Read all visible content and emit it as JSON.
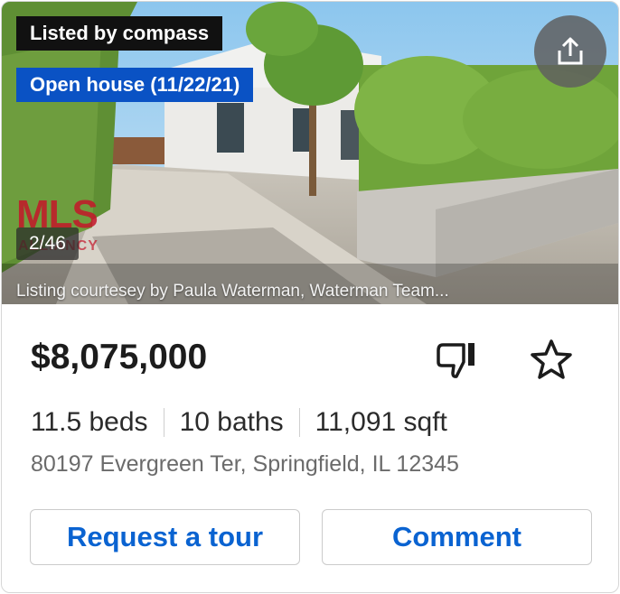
{
  "listing": {
    "listed_by": "Listed by compass",
    "open_house": "Open house (11/22/21)",
    "photo_counter": "2/46",
    "mls_logo_text": "MLS",
    "mls_logo_sub": "ALLIANCY",
    "courtesy": "Listing courtesey by Paula Waterman, Waterman Team...",
    "price": "$8,075,000",
    "beds": "11.5 beds",
    "baths": "10 baths",
    "sqft": "11,091 sqft",
    "address": "80197 Evergreen Ter, Springfield, IL 12345"
  },
  "actions": {
    "request_tour": "Request a tour",
    "comment": "Comment"
  },
  "icons": {
    "share": "share-icon",
    "dislike": "thumbs-down-icon",
    "favorite": "star-icon"
  },
  "colors": {
    "open_house_badge": "#0a52c4",
    "listed_badge": "#111111",
    "button_text": "#0a63d1",
    "mls_red": "#c4162a"
  }
}
